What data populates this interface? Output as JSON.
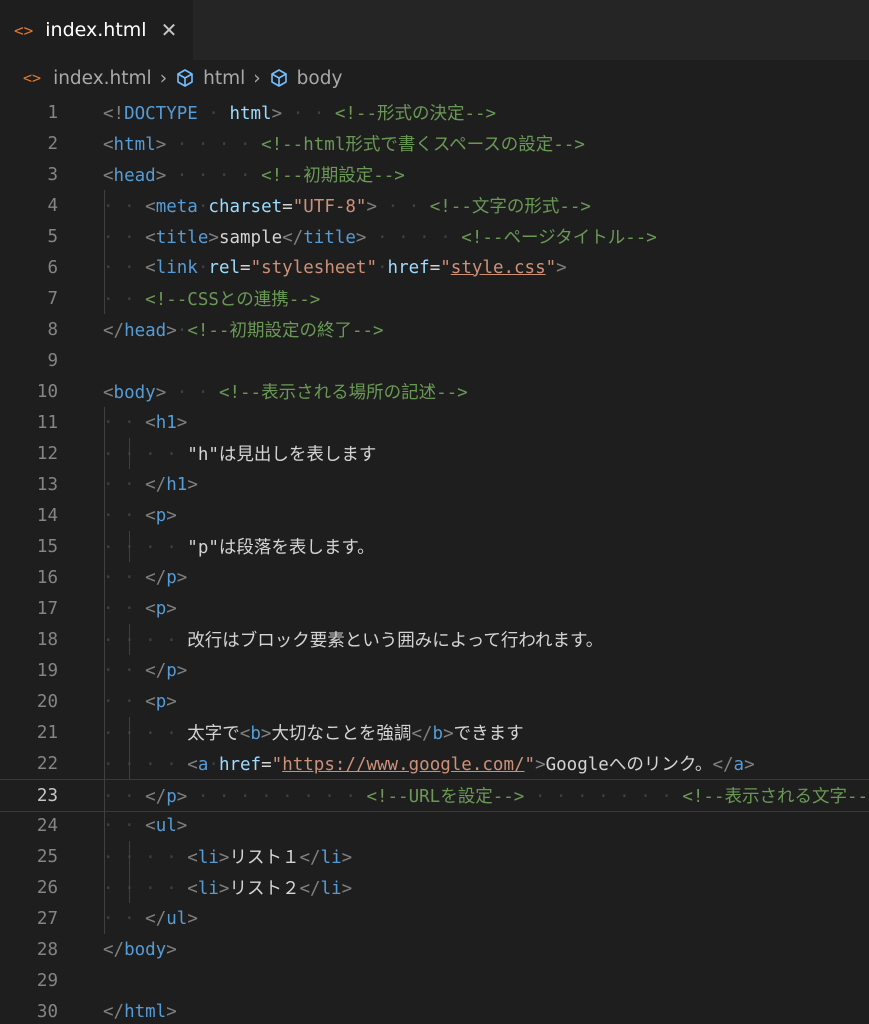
{
  "tab": {
    "icon": "<>",
    "title": "index.html",
    "close": "✕"
  },
  "breadcrumb": {
    "icon": "<>",
    "items": [
      "index.html",
      "html",
      "body"
    ],
    "separator": "›"
  },
  "editor": {
    "lines": [
      {
        "n": "1",
        "tokens": [
          [
            "g",
            "<!"
          ],
          [
            "t",
            "DOCTYPE"
          ],
          [
            "w",
            " · "
          ],
          [
            "a",
            "html"
          ],
          [
            "g",
            ">"
          ],
          [
            "w",
            " · · "
          ],
          [
            "c",
            "<!--形式の決定-->"
          ]
        ]
      },
      {
        "n": "2",
        "tokens": [
          [
            "g",
            "<"
          ],
          [
            "t",
            "html"
          ],
          [
            "g",
            ">"
          ],
          [
            "w",
            " · · · · "
          ],
          [
            "c",
            "<!--html形式で書くスペースの設定-->"
          ]
        ]
      },
      {
        "n": "3",
        "tokens": [
          [
            "g",
            "<"
          ],
          [
            "t",
            "head"
          ],
          [
            "g",
            ">"
          ],
          [
            "w",
            " · · · · "
          ],
          [
            "c",
            "<!--初期設定-->"
          ]
        ]
      },
      {
        "n": "4",
        "tokens": [
          [
            "w",
            "· · "
          ],
          [
            "g",
            "<"
          ],
          [
            "t",
            "meta"
          ],
          [
            "w",
            "·"
          ],
          [
            "a",
            "charset"
          ],
          [
            "x",
            "="
          ],
          [
            "s",
            "\"UTF-8\""
          ],
          [
            "g",
            ">"
          ],
          [
            "w",
            " · · "
          ],
          [
            "c",
            "<!--文字の形式-->"
          ]
        ]
      },
      {
        "n": "5",
        "tokens": [
          [
            "w",
            "· · "
          ],
          [
            "g",
            "<"
          ],
          [
            "t",
            "title"
          ],
          [
            "g",
            ">"
          ],
          [
            "x",
            "sample"
          ],
          [
            "g",
            "</"
          ],
          [
            "t",
            "title"
          ],
          [
            "g",
            ">"
          ],
          [
            "w",
            " · · · · "
          ],
          [
            "c",
            "<!--ページタイトル-->"
          ]
        ]
      },
      {
        "n": "6",
        "tokens": [
          [
            "w",
            "· · "
          ],
          [
            "g",
            "<"
          ],
          [
            "t",
            "link"
          ],
          [
            "w",
            "·"
          ],
          [
            "a",
            "rel"
          ],
          [
            "x",
            "="
          ],
          [
            "s",
            "\"stylesheet\""
          ],
          [
            "w",
            "·"
          ],
          [
            "a",
            "href"
          ],
          [
            "x",
            "="
          ],
          [
            "s",
            "\""
          ],
          [
            "su",
            "style.css"
          ],
          [
            "s",
            "\""
          ],
          [
            "g",
            ">"
          ]
        ]
      },
      {
        "n": "7",
        "tokens": [
          [
            "w",
            "· · "
          ],
          [
            "c",
            "<!--CSSとの連携-->"
          ]
        ]
      },
      {
        "n": "8",
        "tokens": [
          [
            "g",
            "</"
          ],
          [
            "t",
            "head"
          ],
          [
            "g",
            ">"
          ],
          [
            "w",
            "·"
          ],
          [
            "c",
            "<!--初期設定の終了-->"
          ]
        ]
      },
      {
        "n": "9",
        "tokens": []
      },
      {
        "n": "10",
        "tokens": [
          [
            "g",
            "<"
          ],
          [
            "t",
            "body"
          ],
          [
            "g",
            ">"
          ],
          [
            "w",
            " · · "
          ],
          [
            "c",
            "<!--表示される場所の記述-->"
          ]
        ]
      },
      {
        "n": "11",
        "tokens": [
          [
            "w",
            "· · "
          ],
          [
            "g",
            "<"
          ],
          [
            "t",
            "h1"
          ],
          [
            "g",
            ">"
          ]
        ]
      },
      {
        "n": "12",
        "tokens": [
          [
            "w",
            "· · · · "
          ],
          [
            "x",
            "\"h\"は見出しを表します"
          ]
        ]
      },
      {
        "n": "13",
        "tokens": [
          [
            "w",
            "· · "
          ],
          [
            "g",
            "</"
          ],
          [
            "t",
            "h1"
          ],
          [
            "g",
            ">"
          ]
        ]
      },
      {
        "n": "14",
        "tokens": [
          [
            "w",
            "· · "
          ],
          [
            "g",
            "<"
          ],
          [
            "t",
            "p"
          ],
          [
            "g",
            ">"
          ]
        ]
      },
      {
        "n": "15",
        "tokens": [
          [
            "w",
            "· · · · "
          ],
          [
            "x",
            "\"p\"は段落を表します。"
          ]
        ]
      },
      {
        "n": "16",
        "tokens": [
          [
            "w",
            "· · "
          ],
          [
            "g",
            "</"
          ],
          [
            "t",
            "p"
          ],
          [
            "g",
            ">"
          ]
        ]
      },
      {
        "n": "17",
        "tokens": [
          [
            "w",
            "· · "
          ],
          [
            "g",
            "<"
          ],
          [
            "t",
            "p"
          ],
          [
            "g",
            ">"
          ]
        ]
      },
      {
        "n": "18",
        "tokens": [
          [
            "w",
            "· · · · "
          ],
          [
            "x",
            "改行はブロック要素という囲みによって行われます。"
          ]
        ]
      },
      {
        "n": "19",
        "tokens": [
          [
            "w",
            "· · "
          ],
          [
            "g",
            "</"
          ],
          [
            "t",
            "p"
          ],
          [
            "g",
            ">"
          ]
        ]
      },
      {
        "n": "20",
        "tokens": [
          [
            "w",
            "· · "
          ],
          [
            "g",
            "<"
          ],
          [
            "t",
            "p"
          ],
          [
            "g",
            ">"
          ]
        ]
      },
      {
        "n": "21",
        "tokens": [
          [
            "w",
            "· · · · "
          ],
          [
            "x",
            "太字で"
          ],
          [
            "g",
            "<"
          ],
          [
            "t",
            "b"
          ],
          [
            "g",
            ">"
          ],
          [
            "x",
            "大切なことを強調"
          ],
          [
            "g",
            "</"
          ],
          [
            "t",
            "b"
          ],
          [
            "g",
            ">"
          ],
          [
            "x",
            "できます"
          ]
        ]
      },
      {
        "n": "22",
        "tokens": [
          [
            "w",
            "· · · · "
          ],
          [
            "g",
            "<"
          ],
          [
            "t",
            "a"
          ],
          [
            "w",
            "·"
          ],
          [
            "a",
            "href"
          ],
          [
            "x",
            "="
          ],
          [
            "s",
            "\""
          ],
          [
            "su",
            "https://www.google.com/"
          ],
          [
            "s",
            "\""
          ],
          [
            "g",
            ">"
          ],
          [
            "x",
            "Googleへのリンク。"
          ],
          [
            "g",
            "</"
          ],
          [
            "t",
            "a"
          ],
          [
            "g",
            ">"
          ]
        ]
      },
      {
        "n": "23",
        "tokens": [
          [
            "w",
            "· · "
          ],
          [
            "g",
            "</"
          ],
          [
            "t",
            "p"
          ],
          [
            "g",
            ">"
          ],
          [
            "w",
            " · · · · · · · · "
          ],
          [
            "c",
            "<!--URLを設定-->"
          ],
          [
            "w",
            " · · · · · · · "
          ],
          [
            "c",
            "<!--表示される文字-->"
          ]
        ]
      },
      {
        "n": "24",
        "tokens": [
          [
            "w",
            "· · "
          ],
          [
            "g",
            "<"
          ],
          [
            "t",
            "ul"
          ],
          [
            "g",
            ">"
          ]
        ]
      },
      {
        "n": "25",
        "tokens": [
          [
            "w",
            "· · · · "
          ],
          [
            "g",
            "<"
          ],
          [
            "t",
            "li"
          ],
          [
            "g",
            ">"
          ],
          [
            "x",
            "リスト１"
          ],
          [
            "g",
            "</"
          ],
          [
            "t",
            "li"
          ],
          [
            "g",
            ">"
          ]
        ]
      },
      {
        "n": "26",
        "tokens": [
          [
            "w",
            "· · · · "
          ],
          [
            "g",
            "<"
          ],
          [
            "t",
            "li"
          ],
          [
            "g",
            ">"
          ],
          [
            "x",
            "リスト２"
          ],
          [
            "g",
            "</"
          ],
          [
            "t",
            "li"
          ],
          [
            "g",
            ">"
          ]
        ]
      },
      {
        "n": "27",
        "tokens": [
          [
            "w",
            "· · "
          ],
          [
            "g",
            "</"
          ],
          [
            "t",
            "ul"
          ],
          [
            "g",
            ">"
          ]
        ]
      },
      {
        "n": "28",
        "tokens": [
          [
            "g",
            "</"
          ],
          [
            "t",
            "body"
          ],
          [
            "g",
            ">"
          ]
        ]
      },
      {
        "n": "29",
        "tokens": []
      },
      {
        "n": "30",
        "tokens": [
          [
            "g",
            "</"
          ],
          [
            "t",
            "html"
          ],
          [
            "g",
            ">"
          ]
        ]
      }
    ],
    "current_line": "23"
  },
  "colors": {
    "background": "#1e1e1e",
    "tag": "#569cd6",
    "attribute": "#9cdcfe",
    "string": "#ce9178",
    "comment": "#6a9955",
    "file_icon": "#e37933"
  },
  "icons": {
    "file": "html-file-icon",
    "breadcrumb_element": "cube-icon",
    "close": "close-icon"
  }
}
